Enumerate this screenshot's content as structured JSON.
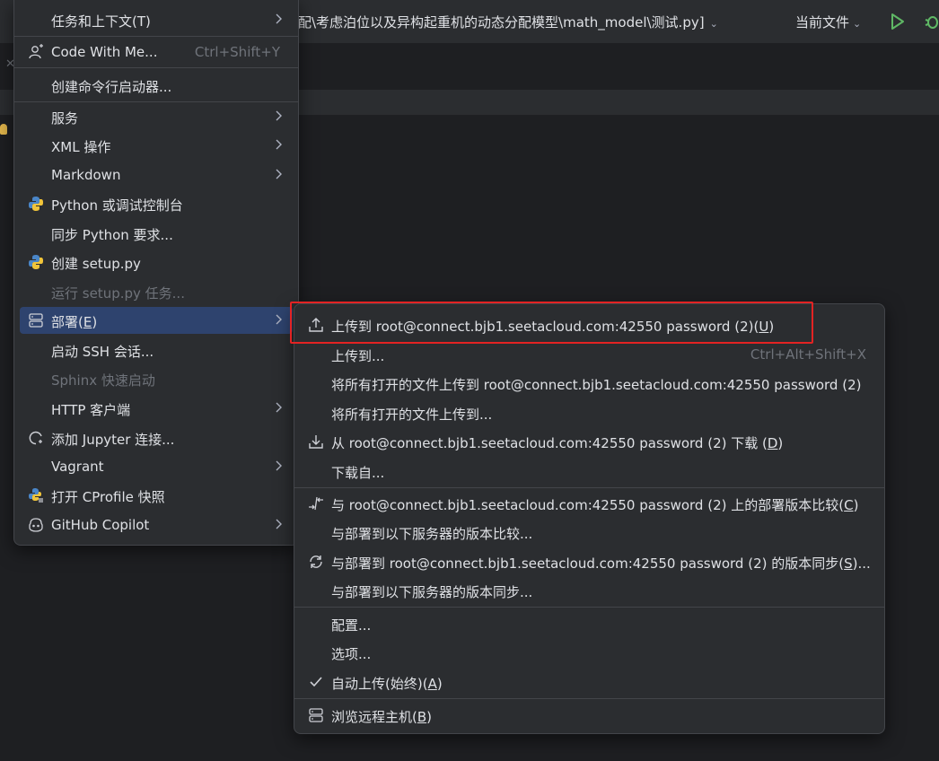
{
  "titlebar": {
    "path": "配\\考虑泊位以及异构起重机的动态分配模型\\math_model\\测试.py]",
    "current_file": "当前文件"
  },
  "menu1": {
    "items": [
      {
        "label": "任务和上下文(T)",
        "arrow": true
      },
      {
        "label": "Code With Me...",
        "shortcut": "Ctrl+Shift+Y",
        "icon": "code-with-me-icon"
      },
      {
        "label": "创建命令行启动器..."
      },
      {
        "label": "服务",
        "arrow": true
      },
      {
        "label": "XML 操作",
        "arrow": true
      },
      {
        "label": "Markdown",
        "arrow": true
      },
      {
        "label": "Python 或调试控制台",
        "icon": "python-console-icon"
      },
      {
        "label": "同步 Python 要求..."
      },
      {
        "label": "创建 setup.py",
        "icon": "python-icon"
      },
      {
        "label": "运行 setup.py 任务...",
        "disabled": true
      },
      {
        "label": "部署(E)",
        "arrow": true,
        "selected": true,
        "icon": "server-icon"
      },
      {
        "label": "启动 SSH 会话..."
      },
      {
        "label": "Sphinx 快速启动",
        "disabled": true
      },
      {
        "label": "HTTP 客户端",
        "arrow": true
      },
      {
        "label": "添加 Jupyter 连接...",
        "icon": "jupyter-icon"
      },
      {
        "label": "Vagrant",
        "arrow": true
      },
      {
        "label": "打开 CProfile 快照",
        "icon": "cprofile-icon"
      },
      {
        "label": "GitHub Copilot",
        "arrow": true,
        "icon": "github-copilot-icon"
      }
    ]
  },
  "menu2": {
    "items": [
      {
        "label": "上传到 root@connect.bjb1.seetacloud.com:42550 password (2)(U)",
        "icon": "upload-icon"
      },
      {
        "label": "上传到...",
        "shortcut": "Ctrl+Alt+Shift+X"
      },
      {
        "label": "将所有打开的文件上传到 root@connect.bjb1.seetacloud.com:42550 password (2)"
      },
      {
        "label": "将所有打开的文件上传到..."
      },
      {
        "label": "从 root@connect.bjb1.seetacloud.com:42550 password (2) 下载 (D)",
        "icon": "download-icon"
      },
      {
        "label": "下载自..."
      },
      {
        "label": "与 root@connect.bjb1.seetacloud.com:42550 password (2) 上的部署版本比较(C)",
        "icon": "compare-icon"
      },
      {
        "label": "与部署到以下服务器的版本比较..."
      },
      {
        "label": "与部署到 root@connect.bjb1.seetacloud.com:42550 password (2) 的版本同步(S)...",
        "icon": "sync-icon"
      },
      {
        "label": "与部署到以下服务器的版本同步..."
      },
      {
        "label": "配置..."
      },
      {
        "label": "选项..."
      },
      {
        "label": "自动上传(始终)(A)",
        "icon": "checkmark-icon"
      },
      {
        "label": "浏览远程主机(B)",
        "icon": "server-icon"
      }
    ]
  }
}
